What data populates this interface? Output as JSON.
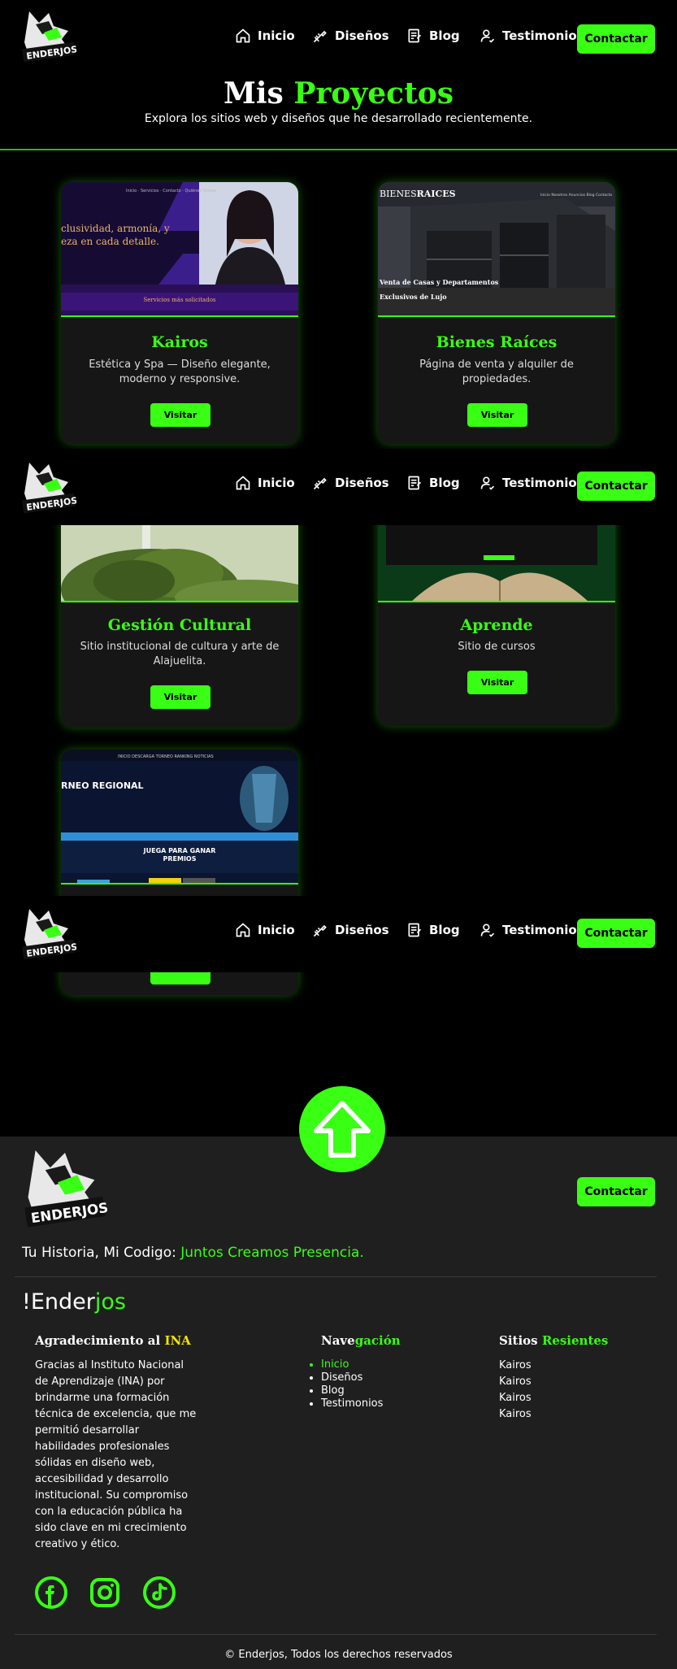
{
  "nav": {
    "items": [
      {
        "label": "Inicio",
        "icon": "home-icon"
      },
      {
        "label": "Diseños",
        "icon": "pen-ruler-icon"
      },
      {
        "label": "Blog",
        "icon": "blog-icon"
      },
      {
        "label": "Testimonios",
        "icon": "user-check-icon"
      }
    ],
    "contact_label": "Contactar",
    "logo_text": "ENDERJOS"
  },
  "header": {
    "title_main": "Mis",
    "title_accent": "Proyectos",
    "subtitle": "Explora los sitios web y diseños que he desarrollado recientemente."
  },
  "projects": [
    {
      "title": "Kairos",
      "desc": "Estética y Spa — Diseño elegante, moderno y responsive.",
      "button": "Visitar",
      "thumb_text_1": "clusividad, armonía, y",
      "thumb_text_2": "eza en cada detalle.",
      "thumb_bar": "Servicios más solicitados"
    },
    {
      "title": "Bienes Raíces",
      "desc": "Página de venta y alquiler de propiedades.",
      "button": "Visitar",
      "thumb_brand_1": "BIENES",
      "thumb_brand_2": "RAICES",
      "thumb_text_1": "Venta de Casas y Departamentos",
      "thumb_text_2": "Exclusivos de Lujo"
    },
    {
      "title": "Gestión Cultural",
      "desc": "Sitio institucional de cultura y arte de Alajuelita.",
      "button": "Visitar"
    },
    {
      "title": "Aprende",
      "desc": "Sitio de cursos",
      "button": "Visitar"
    },
    {
      "title": "",
      "desc": "",
      "button": "",
      "thumb_text_1": "RNEO REGIONAL",
      "thumb_text_2": "JUEGA PARA GANAR",
      "thumb_text_3": "PREMIOS"
    }
  ],
  "footer": {
    "contact_label": "Contactar",
    "tagline_main": "Tu Historia, Mi Codigo:",
    "tagline_accent": "Juntos Creamos Presencia.",
    "brand_main": "!Ender",
    "brand_accent": "jos",
    "col1": {
      "heading_main": "Agradecimiento al",
      "heading_accent": "INA",
      "text": "Gracias al Instituto Nacional de Aprendizaje (INA) por brindarme una formación técnica de excelencia, que me permitió desarrollar habilidades profesionales sólidas en diseño web, accesibilidad y desarrollo institucional. Su compromiso con la educación pública ha sido clave en mi crecimiento creativo y ético."
    },
    "col2": {
      "heading_main": "Nave",
      "heading_accent": "gación",
      "links": [
        "Inicio",
        "Diseños",
        "Blog",
        "Testimonios"
      ]
    },
    "col3": {
      "heading_main": "Sitios",
      "heading_accent": "Resientes",
      "links": [
        "Kairos",
        "Kairos",
        "Kairos",
        "Kairos"
      ]
    },
    "social": [
      "facebook-icon",
      "instagram-icon",
      "tiktok-icon"
    ],
    "copyright": "© Enderjos, Todos los derechos reservados"
  },
  "colors": {
    "accent": "#39ff14",
    "background": "#000000",
    "card": "#161616",
    "footer": "#1f1f1f",
    "yellow": "#f2e300"
  }
}
